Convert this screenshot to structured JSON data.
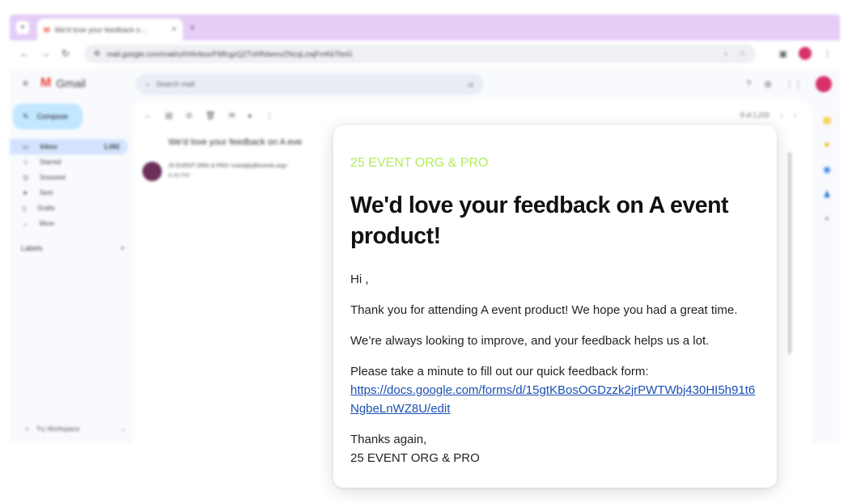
{
  "browser": {
    "tab_title": "We'd love your feedback o...",
    "url": "mail.google.com/mail/u/0/#inbox/FMfcgzQZTvhRdwmvZNcqLzwjFmKkTbnG",
    "tab_close": "×",
    "new_tab": "+"
  },
  "gmail": {
    "app_name": "Gmail",
    "search_placeholder": "Search mail",
    "compose_label": "Compose",
    "nav_items": [
      {
        "label": "Inbox",
        "count": "1,082"
      },
      {
        "label": "Starred",
        "count": ""
      },
      {
        "label": "Snoozed",
        "count": ""
      },
      {
        "label": "Sent",
        "count": ""
      },
      {
        "label": "Drafts",
        "count": ""
      },
      {
        "label": "More",
        "count": ""
      }
    ],
    "labels_heading": "Labels",
    "upgrade_label": "Try Workspace",
    "pagination": "8 of 1,233",
    "blurred_subject": "We'd love your feedback on A eve",
    "blurred_sender": "25 EVENT ORG & PRO",
    "blurred_sender_email": "<noreply@events.org>",
    "blurred_time": "8:46 PM"
  },
  "email": {
    "org": "25 EVENT ORG & PRO",
    "title": "We'd love your feedback on A event product!",
    "greeting": "Hi ,",
    "p1": "Thank you for attending A event product! We hope you had a great time.",
    "p2": "We’re always looking to improve, and your feedback helps us a lot.",
    "p3": "Please take a minute to fill out our quick feedback form:",
    "link": "https://docs.google.com/forms/d/15gtKBosOGDzzk2jrPWTWbj430HI5h91t6NgbeLnWZ8U/edit",
    "signoff": "Thanks again,",
    "signature": "25 EVENT ORG & PRO"
  },
  "colors": {
    "org_accent": "#b2ec5d",
    "link": "#1a4fb4",
    "tabstrip": "#e5cdf6",
    "compose_bg": "#c2e7ff",
    "avatar": "#d8306a"
  }
}
